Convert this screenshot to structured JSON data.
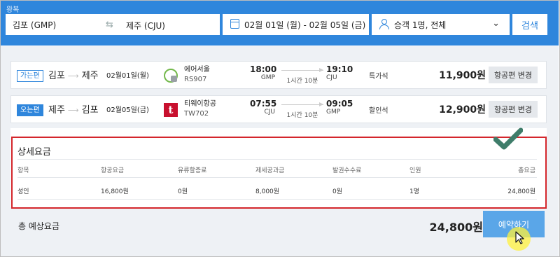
{
  "search": {
    "trip_type": "왕복",
    "from": "김포 (GMP)",
    "to": "제주 (CJU)",
    "dates": "02월 01일 (월) - 02월 05일 (금)",
    "passengers": "승객 1명, 전체",
    "search_label": "검색",
    "accent_color": "#2f86dc"
  },
  "flights": [
    {
      "direction": "가는편",
      "origin": "김포",
      "destination": "제주",
      "date": "02월01일(월)",
      "airline": "에어서울",
      "flight_no": "RS907",
      "airline_icon": "air-seoul-logo",
      "dep_time": "18:00",
      "dep_airport": "GMP",
      "duration": "1시간 10분",
      "arr_time": "19:10",
      "arr_airport": "CJU",
      "fare_class": "특가석",
      "price": "11,900원",
      "change_label": "항공편 변경"
    },
    {
      "direction": "오는편",
      "origin": "제주",
      "destination": "김포",
      "date": "02월05일(금)",
      "airline": "티웨이항공",
      "flight_no": "TW702",
      "airline_icon": "tway-logo",
      "dep_time": "07:55",
      "dep_airport": "CJU",
      "duration": "1시간 10분",
      "arr_time": "09:05",
      "arr_airport": "GMP",
      "fare_class": "할인석",
      "price": "12,900원",
      "change_label": "항공편 변경"
    }
  ],
  "details": {
    "title": "상세요금",
    "headers": [
      "항목",
      "항공요금",
      "유류할증료",
      "제세공과금",
      "발권수수료",
      "인원",
      "총요금"
    ],
    "rows": [
      [
        "성인",
        "16,800원",
        "0원",
        "8,000원",
        "0원",
        "1명",
        "24,800원"
      ]
    ],
    "highlight_color": "#d4262c"
  },
  "total": {
    "label": "총 예상요금",
    "value": "24,800원",
    "reserve_label": "예약하기"
  }
}
